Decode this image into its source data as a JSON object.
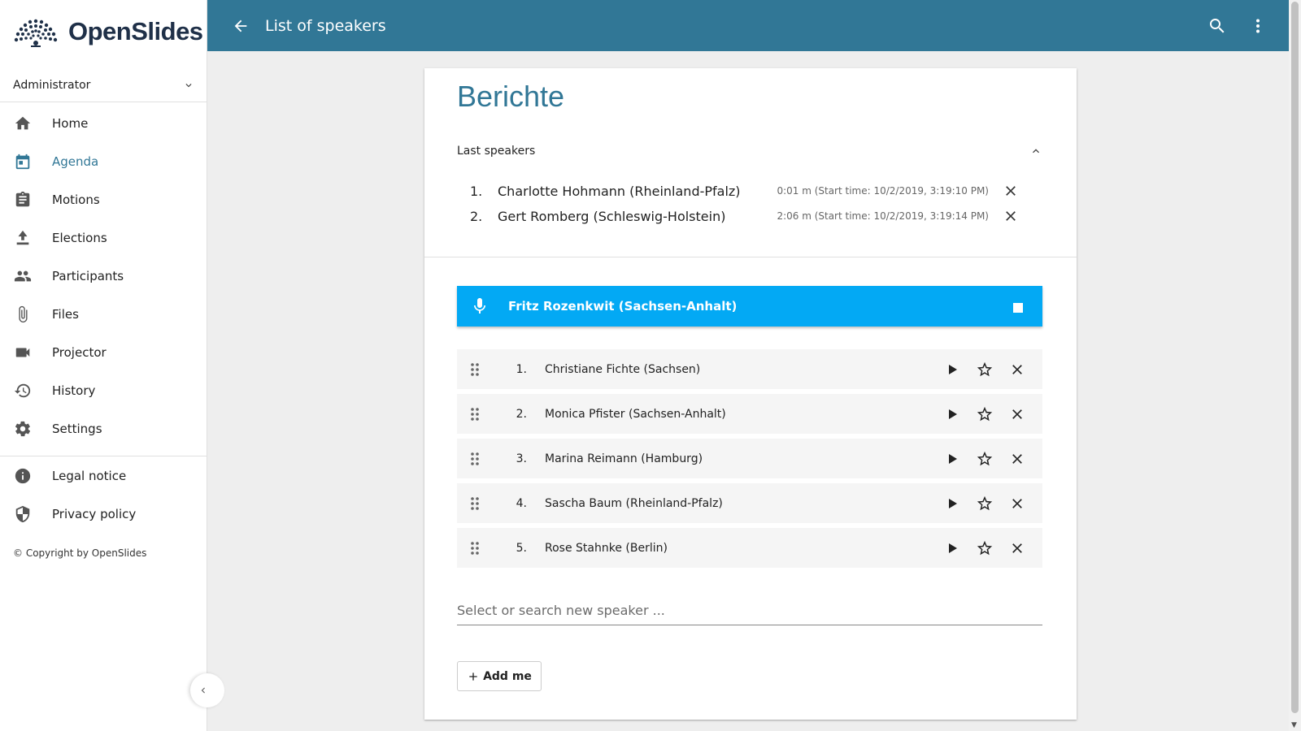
{
  "app": {
    "logo_text": "OpenSlides",
    "brand_color": "#317796",
    "accent_color": "#03a9f4"
  },
  "sidebar": {
    "user": "Administrator",
    "items": [
      {
        "label": "Home",
        "icon": "home-icon"
      },
      {
        "label": "Agenda",
        "icon": "calendar-icon",
        "active": true
      },
      {
        "label": "Motions",
        "icon": "clipboard-icon"
      },
      {
        "label": "Elections",
        "icon": "ballot-icon"
      },
      {
        "label": "Participants",
        "icon": "people-icon"
      },
      {
        "label": "Files",
        "icon": "paperclip-icon"
      },
      {
        "label": "Projector",
        "icon": "videocam-icon"
      },
      {
        "label": "History",
        "icon": "history-icon"
      },
      {
        "label": "Settings",
        "icon": "gear-icon"
      }
    ],
    "secondary": [
      {
        "label": "Legal notice",
        "icon": "info-icon"
      },
      {
        "label": "Privacy policy",
        "icon": "shield-icon"
      }
    ],
    "copyright": "© Copyright by OpenSlides"
  },
  "toolbar": {
    "title": "List of speakers"
  },
  "card": {
    "title": "Berichte",
    "last_speakers": {
      "title": "Last speakers",
      "items": [
        {
          "num": "1.",
          "name": "Charlotte Hohmann (Rheinland-Pfalz)",
          "meta": "0:01 m (Start time: 10/2/2019, 3:19:10 PM)"
        },
        {
          "num": "2.",
          "name": "Gert Romberg (Schleswig-Holstein)",
          "meta": "2:06 m (Start time: 10/2/2019, 3:19:14 PM)"
        }
      ]
    },
    "current_speaker": "Fritz Rozenkwit (Sachsen-Anhalt)",
    "queue": [
      {
        "num": "1.",
        "name": "Christiane Fichte (Sachsen)"
      },
      {
        "num": "2.",
        "name": "Monica Pfister (Sachsen-Anhalt)"
      },
      {
        "num": "3.",
        "name": "Marina Reimann (Hamburg)"
      },
      {
        "num": "4.",
        "name": "Sascha Baum (Rheinland-Pfalz)"
      },
      {
        "num": "5.",
        "name": "Rose Stahnke (Berlin)"
      }
    ],
    "search_placeholder": "Select or search new speaker ...",
    "add_me_label": "Add me"
  }
}
